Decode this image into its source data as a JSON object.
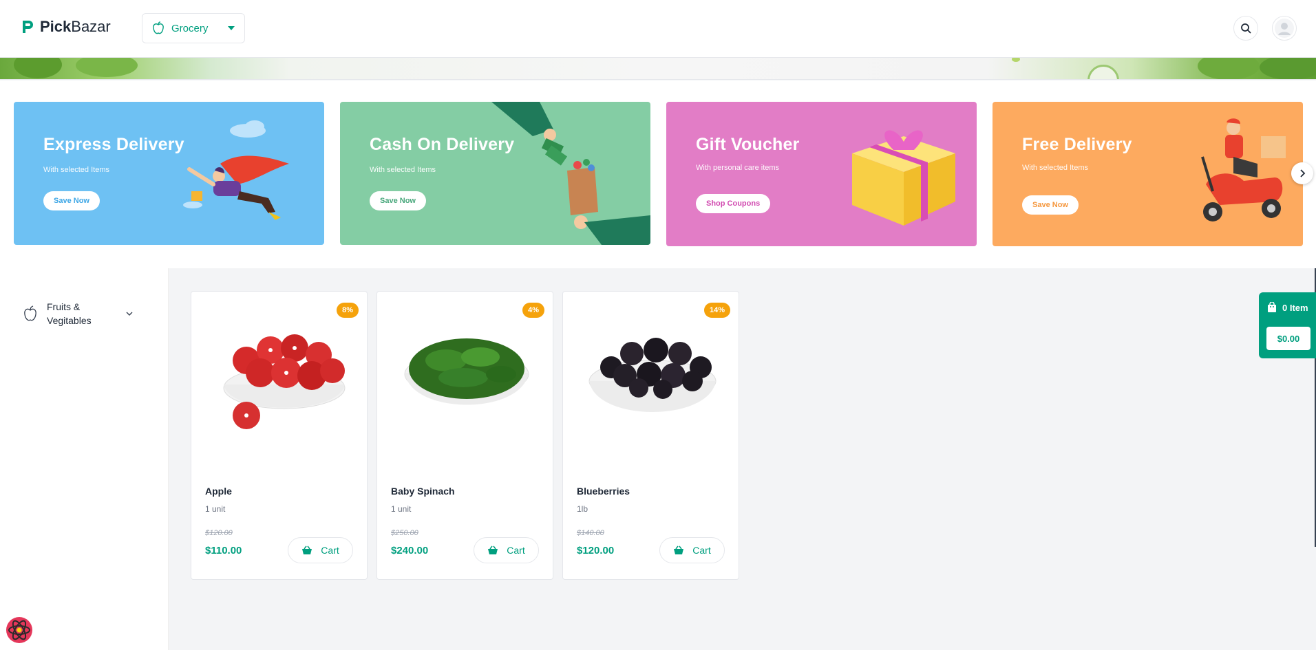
{
  "header": {
    "brand_bold": "Pick",
    "brand_rest": "Bazar",
    "shop_type": {
      "label": "Grocery",
      "icon": "apple-icon"
    },
    "search_icon": "search-icon",
    "avatar_icon": "user-avatar-icon"
  },
  "promos": [
    {
      "title": "Express Delivery",
      "subtitle": "With selected Items",
      "button": "Save Now",
      "bg": "#6ec1f3",
      "btn_color": "#3ea7e6"
    },
    {
      "title": "Cash On Delivery",
      "subtitle": "With selected Items",
      "button": "Save Now",
      "bg": "#84cda4",
      "btn_color": "#48a77b"
    },
    {
      "title": "Gift Voucher",
      "subtitle": "With personal care items",
      "button": "Shop Coupons",
      "bg": "#e27dc6",
      "btn_color": "#d14ab0"
    },
    {
      "title": "Free Delivery",
      "subtitle": "With selected Items",
      "button": "Save Now",
      "bg": "#fdaa5f",
      "btn_color": "#f5973d"
    }
  ],
  "sidebar": {
    "categories": [
      {
        "label": "Fruits & Vegitables",
        "icon": "apple-outline-icon"
      }
    ]
  },
  "products": [
    {
      "name": "Apple",
      "unit": "1 unit",
      "old_price": "$120.00",
      "price": "$110.00",
      "discount": "8%",
      "cart_label": "Cart"
    },
    {
      "name": "Baby Spinach",
      "unit": "1 unit",
      "old_price": "$250.00",
      "price": "$240.00",
      "discount": "4%",
      "cart_label": "Cart"
    },
    {
      "name": "Blueberries",
      "unit": "1lb",
      "old_price": "$140.00",
      "price": "$120.00",
      "discount": "14%",
      "cart_label": "Cart"
    }
  ],
  "floating_cart": {
    "items_label": "0 Item",
    "total": "$0.00"
  },
  "colors": {
    "accent": "#009f7f",
    "badge": "#f5a20b"
  }
}
